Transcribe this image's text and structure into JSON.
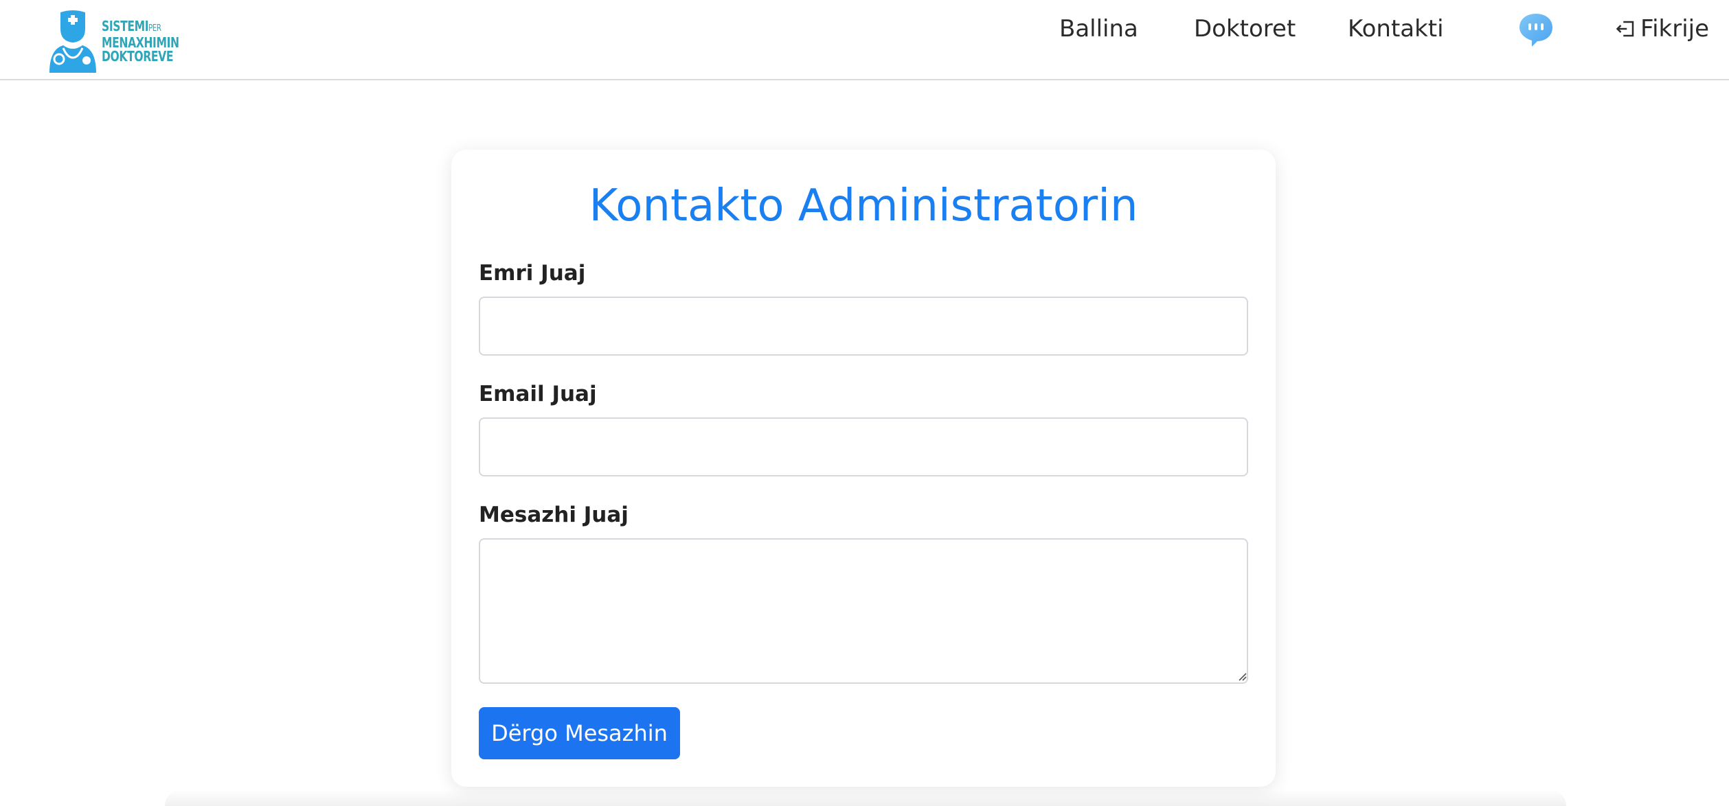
{
  "logo": {
    "line1": "SISTEMI",
    "line1_small": "PER",
    "line2": "MENAXHIMIN",
    "line3": "DOKTOREVE"
  },
  "nav": {
    "items": [
      {
        "label": "Ballina"
      },
      {
        "label": "Doktoret"
      },
      {
        "label": "Kontakti"
      }
    ],
    "chat_icon": "chat-bubble-icon",
    "logout_icon": "sign-out-icon",
    "user_label": "Fikrije"
  },
  "form": {
    "title": "Kontakto Administratorin",
    "name_label": "Emri Juaj",
    "name_value": "",
    "email_label": "Email Juaj",
    "email_value": "",
    "message_label": "Mesazhi Juaj",
    "message_value": "",
    "submit_label": "Dërgo Mesazhin"
  },
  "colors": {
    "accent": "#1a7ff0",
    "button": "#1c74f0",
    "logo": "#2ea6b8",
    "chat_icon": "#63b3f5"
  }
}
